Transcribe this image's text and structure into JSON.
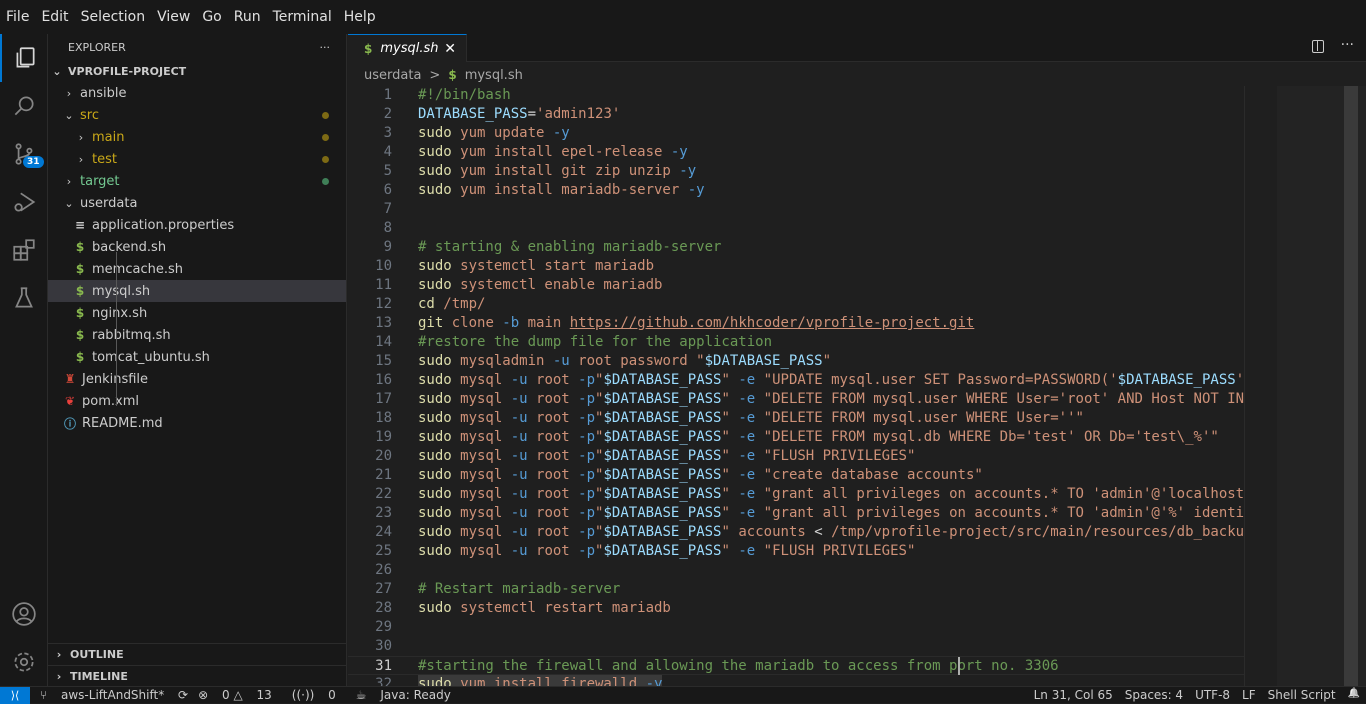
{
  "menu": [
    "File",
    "Edit",
    "Selection",
    "View",
    "Go",
    "Run",
    "Terminal",
    "Help"
  ],
  "activity": {
    "scm_badge": "31"
  },
  "explorer": {
    "title": "EXPLORER",
    "more": "···",
    "project": "VPROFILE-PROJECT",
    "items": [
      {
        "label": "ansible",
        "type": "folder",
        "open": false,
        "depth": 1,
        "color": "#cccccc"
      },
      {
        "label": "src",
        "type": "folder",
        "open": true,
        "depth": 1,
        "color": "#c9a818",
        "dot": "#7d6a14"
      },
      {
        "label": "main",
        "type": "folder",
        "open": false,
        "depth": 2,
        "color": "#c9a818",
        "dot": "#7d6a14"
      },
      {
        "label": "test",
        "type": "folder",
        "open": false,
        "depth": 2,
        "color": "#c9a818",
        "dot": "#7d6a14"
      },
      {
        "label": "target",
        "type": "folder",
        "open": false,
        "depth": 1,
        "color": "#73c991",
        "dot": "#3f7f57"
      },
      {
        "label": "userdata",
        "type": "folder",
        "open": true,
        "depth": 1,
        "color": "#cccccc"
      },
      {
        "label": "application.properties",
        "type": "props",
        "depth": 2,
        "color": "#cccccc"
      },
      {
        "label": "backend.sh",
        "type": "sh",
        "depth": 2,
        "color": "#cccccc"
      },
      {
        "label": "memcache.sh",
        "type": "sh",
        "depth": 2,
        "color": "#cccccc"
      },
      {
        "label": "mysql.sh",
        "type": "sh",
        "depth": 2,
        "color": "#cccccc",
        "selected": true
      },
      {
        "label": "nginx.sh",
        "type": "sh",
        "depth": 2,
        "color": "#cccccc"
      },
      {
        "label": "rabbitmq.sh",
        "type": "sh",
        "depth": 2,
        "color": "#cccccc"
      },
      {
        "label": "tomcat_ubuntu.sh",
        "type": "sh",
        "depth": 2,
        "color": "#cccccc"
      },
      {
        "label": "Jenkinsfile",
        "type": "jenkins",
        "depth": 1,
        "color": "#cccccc"
      },
      {
        "label": "pom.xml",
        "type": "maven",
        "depth": 1,
        "color": "#cccccc"
      },
      {
        "label": "README.md",
        "type": "info",
        "depth": 1,
        "color": "#cccccc"
      }
    ],
    "outline": "OUTLINE",
    "timeline": "TIMELINE"
  },
  "tab": {
    "label": "mysql.sh",
    "close": "✕"
  },
  "breadcrumb": {
    "folder": "userdata",
    "sep": ">",
    "file": "mysql.sh"
  },
  "editor": {
    "current_line": 31,
    "lines": [
      [
        [
          "c",
          "#!/bin/bash"
        ]
      ],
      [
        [
          "v",
          "DATABASE_PASS"
        ],
        [
          "t",
          "="
        ],
        [
          "s",
          "'admin123'"
        ]
      ],
      [
        [
          "k",
          "sudo"
        ],
        [
          "s",
          " yum update"
        ],
        [
          "f",
          " -y"
        ]
      ],
      [
        [
          "k",
          "sudo"
        ],
        [
          "s",
          " yum install epel-release"
        ],
        [
          "f",
          " -y"
        ]
      ],
      [
        [
          "k",
          "sudo"
        ],
        [
          "s",
          " yum install git zip unzip"
        ],
        [
          "f",
          " -y"
        ]
      ],
      [
        [
          "k",
          "sudo"
        ],
        [
          "s",
          " yum install mariadb-server"
        ],
        [
          "f",
          " -y"
        ]
      ],
      [],
      [],
      [
        [
          "c",
          "# starting & enabling mariadb-server"
        ]
      ],
      [
        [
          "k",
          "sudo"
        ],
        [
          "s",
          " systemctl start mariadb"
        ]
      ],
      [
        [
          "k",
          "sudo"
        ],
        [
          "s",
          " systemctl enable mariadb"
        ]
      ],
      [
        [
          "k",
          "cd"
        ],
        [
          "s",
          " /tmp/"
        ]
      ],
      [
        [
          "k",
          "git"
        ],
        [
          "s",
          " clone"
        ],
        [
          "f",
          " -b"
        ],
        [
          "s",
          " main "
        ],
        [
          "u",
          "https://github.com/hkhcoder/vprofile-project.git"
        ]
      ],
      [
        [
          "c",
          "#restore the dump file for the application"
        ]
      ],
      [
        [
          "k",
          "sudo"
        ],
        [
          "s",
          " mysqladmin"
        ],
        [
          "f",
          " -u"
        ],
        [
          "s",
          " root password \""
        ],
        [
          "v",
          "$DATABASE_PASS"
        ],
        [
          "s",
          "\""
        ]
      ],
      [
        [
          "k",
          "sudo"
        ],
        [
          "s",
          " mysql"
        ],
        [
          "f",
          " -u"
        ],
        [
          "s",
          " root"
        ],
        [
          "f",
          " -p"
        ],
        [
          "s",
          "\""
        ],
        [
          "v",
          "$DATABASE_PASS"
        ],
        [
          "s",
          "\""
        ],
        [
          "f",
          " -e"
        ],
        [
          "s",
          " \"UPDATE mysql.user SET Password=PASSWORD('"
        ],
        [
          "v",
          "$DATABASE_PASS"
        ],
        [
          "s",
          "')"
        ]
      ],
      [
        [
          "k",
          "sudo"
        ],
        [
          "s",
          " mysql"
        ],
        [
          "f",
          " -u"
        ],
        [
          "s",
          " root"
        ],
        [
          "f",
          " -p"
        ],
        [
          "s",
          "\""
        ],
        [
          "v",
          "$DATABASE_PASS"
        ],
        [
          "s",
          "\""
        ],
        [
          "f",
          " -e"
        ],
        [
          "s",
          " \"DELETE FROM mysql.user WHERE User='root' AND Host NOT IN"
        ]
      ],
      [
        [
          "k",
          "sudo"
        ],
        [
          "s",
          " mysql"
        ],
        [
          "f",
          " -u"
        ],
        [
          "s",
          " root"
        ],
        [
          "f",
          " -p"
        ],
        [
          "s",
          "\""
        ],
        [
          "v",
          "$DATABASE_PASS"
        ],
        [
          "s",
          "\""
        ],
        [
          "f",
          " -e"
        ],
        [
          "s",
          " \"DELETE FROM mysql.user WHERE User=''\""
        ]
      ],
      [
        [
          "k",
          "sudo"
        ],
        [
          "s",
          " mysql"
        ],
        [
          "f",
          " -u"
        ],
        [
          "s",
          " root"
        ],
        [
          "f",
          " -p"
        ],
        [
          "s",
          "\""
        ],
        [
          "v",
          "$DATABASE_PASS"
        ],
        [
          "s",
          "\""
        ],
        [
          "f",
          " -e"
        ],
        [
          "s",
          " \"DELETE FROM mysql.db WHERE Db='test' OR Db='test\\_%'\""
        ]
      ],
      [
        [
          "k",
          "sudo"
        ],
        [
          "s",
          " mysql"
        ],
        [
          "f",
          " -u"
        ],
        [
          "s",
          " root"
        ],
        [
          "f",
          " -p"
        ],
        [
          "s",
          "\""
        ],
        [
          "v",
          "$DATABASE_PASS"
        ],
        [
          "s",
          "\""
        ],
        [
          "f",
          " -e"
        ],
        [
          "s",
          " \"FLUSH PRIVILEGES\""
        ]
      ],
      [
        [
          "k",
          "sudo"
        ],
        [
          "s",
          " mysql"
        ],
        [
          "f",
          " -u"
        ],
        [
          "s",
          " root"
        ],
        [
          "f",
          " -p"
        ],
        [
          "s",
          "\""
        ],
        [
          "v",
          "$DATABASE_PASS"
        ],
        [
          "s",
          "\""
        ],
        [
          "f",
          " -e"
        ],
        [
          "s",
          " \"create database accounts\""
        ]
      ],
      [
        [
          "k",
          "sudo"
        ],
        [
          "s",
          " mysql"
        ],
        [
          "f",
          " -u"
        ],
        [
          "s",
          " root"
        ],
        [
          "f",
          " -p"
        ],
        [
          "s",
          "\""
        ],
        [
          "v",
          "$DATABASE_PASS"
        ],
        [
          "s",
          "\""
        ],
        [
          "f",
          " -e"
        ],
        [
          "s",
          " \"grant all privileges on accounts.* TO 'admin'@'localhost'"
        ]
      ],
      [
        [
          "k",
          "sudo"
        ],
        [
          "s",
          " mysql"
        ],
        [
          "f",
          " -u"
        ],
        [
          "s",
          " root"
        ],
        [
          "f",
          " -p"
        ],
        [
          "s",
          "\""
        ],
        [
          "v",
          "$DATABASE_PASS"
        ],
        [
          "s",
          "\""
        ],
        [
          "f",
          " -e"
        ],
        [
          "s",
          " \"grant all privileges on accounts.* TO 'admin'@'%' identi"
        ]
      ],
      [
        [
          "k",
          "sudo"
        ],
        [
          "s",
          " mysql"
        ],
        [
          "f",
          " -u"
        ],
        [
          "s",
          " root"
        ],
        [
          "f",
          " -p"
        ],
        [
          "s",
          "\""
        ],
        [
          "v",
          "$DATABASE_PASS"
        ],
        [
          "s",
          "\" accounts "
        ],
        [
          "t",
          "<"
        ],
        [
          "s",
          " /tmp/vprofile-project/src/main/resources/db_backup"
        ]
      ],
      [
        [
          "k",
          "sudo"
        ],
        [
          "s",
          " mysql"
        ],
        [
          "f",
          " -u"
        ],
        [
          "s",
          " root"
        ],
        [
          "f",
          " -p"
        ],
        [
          "s",
          "\""
        ],
        [
          "v",
          "$DATABASE_PASS"
        ],
        [
          "s",
          "\""
        ],
        [
          "f",
          " -e"
        ],
        [
          "s",
          " \"FLUSH PRIVILEGES\""
        ]
      ],
      [],
      [
        [
          "c",
          "# Restart mariadb-server"
        ]
      ],
      [
        [
          "k",
          "sudo"
        ],
        [
          "s",
          " systemctl restart mariadb"
        ]
      ],
      [],
      [],
      [
        [
          "c",
          "#starting the firewall and allowing the mariadb to access from port no. 3306"
        ]
      ],
      [
        [
          "k",
          "sudo"
        ],
        [
          "s",
          " yum install firewalld"
        ],
        [
          "f",
          " -y"
        ]
      ]
    ]
  },
  "status": {
    "remote": "⟩⟨",
    "branch": "aws-LiftAndShift*",
    "sync": "⟳",
    "errors": "0",
    "warnings": "13",
    "ports": "0",
    "java": "Java: Ready",
    "position": "Ln 31, Col 65",
    "spaces": "Spaces: 4",
    "encoding": "UTF-8",
    "eol": "LF",
    "language": "Shell Script",
    "bell": "🔔"
  },
  "colors": {
    "accent": "#0078d4",
    "comment": "#6a9955",
    "string": "#ce9178",
    "keyword": "#dcdcaa",
    "variable": "#9cdcfe",
    "flag": "#569cd6"
  }
}
